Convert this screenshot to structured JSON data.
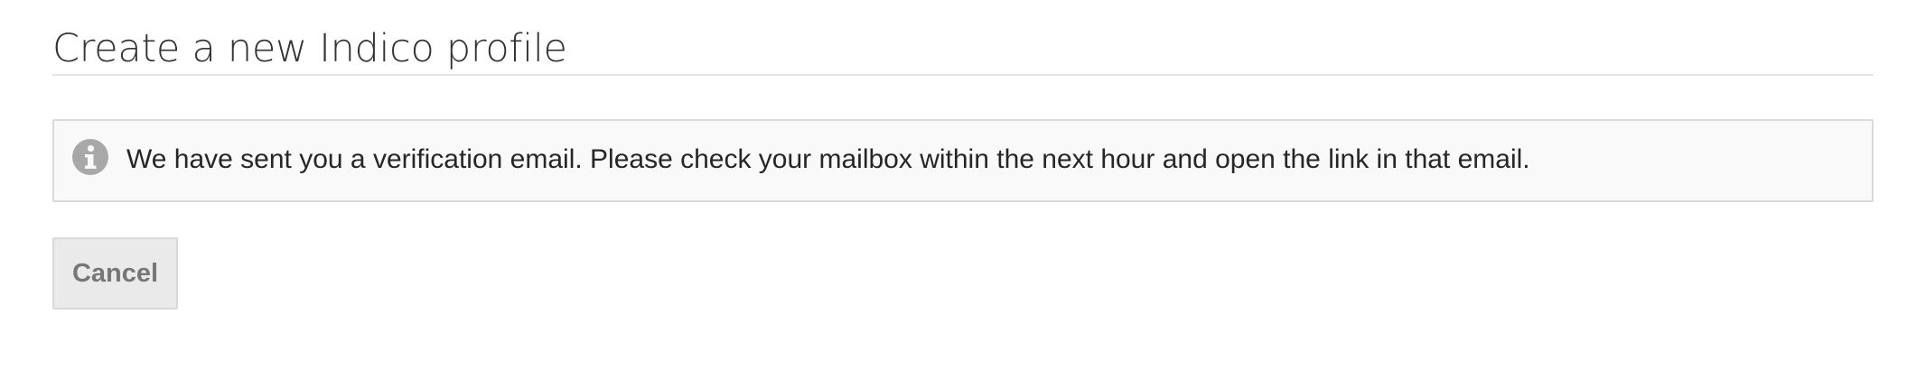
{
  "page": {
    "title": "Create a new Indico profile"
  },
  "notice": {
    "icon": "info-circle-icon",
    "message": "We have sent you a verification email. Please check your mailbox within the next hour and open the link in that email."
  },
  "actions": {
    "cancel_label": "Cancel"
  },
  "colors": {
    "title_text": "#333333",
    "notice_background": "#f9f9f9",
    "notice_border": "#dadada",
    "icon": "#a8a8a8",
    "button_background": "#eaeaea",
    "button_text": "#777777"
  }
}
